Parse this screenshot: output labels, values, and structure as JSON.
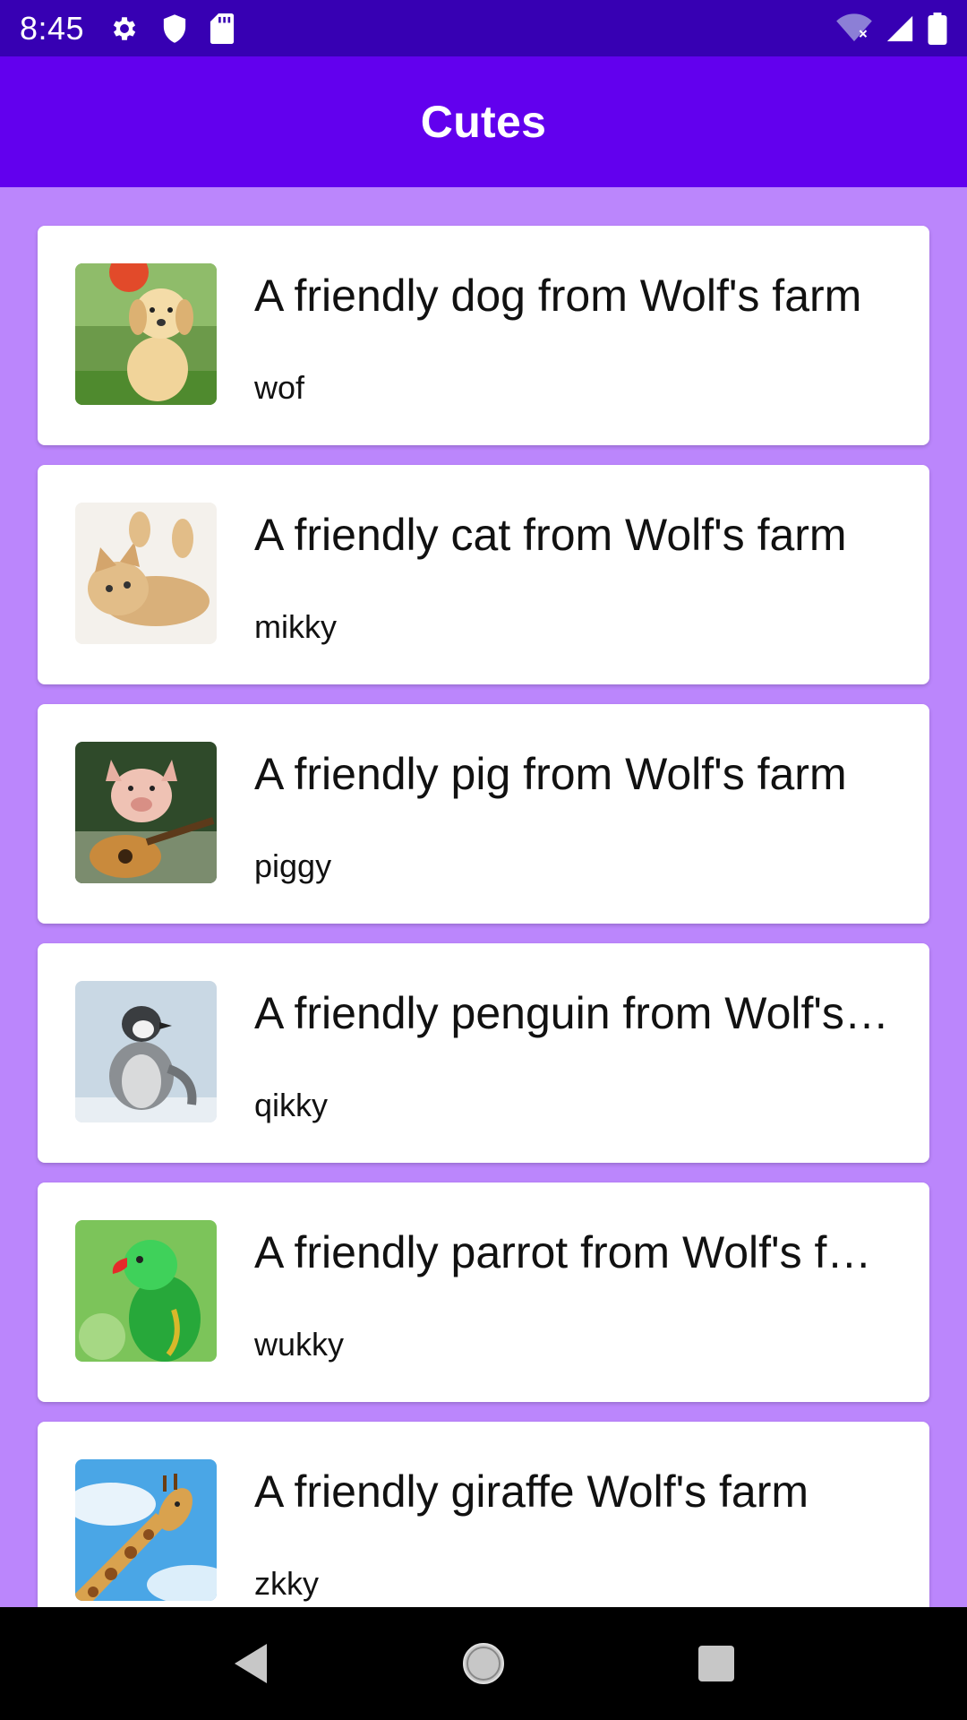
{
  "status_bar": {
    "time": "8:45",
    "left_icons": [
      "settings-icon",
      "shield-icon",
      "sd-card-icon"
    ],
    "right_icons": [
      "wifi-off-icon",
      "signal-icon",
      "battery-icon"
    ]
  },
  "app_bar": {
    "title": "Cutes"
  },
  "items": [
    {
      "title": "A friendly dog from Wolf's farm",
      "subtitle": "wof",
      "image": "dog"
    },
    {
      "title": "A friendly cat from Wolf's farm",
      "subtitle": "mikky",
      "image": "cat"
    },
    {
      "title": "A friendly pig from Wolf's farm",
      "subtitle": "piggy",
      "image": "pig"
    },
    {
      "title": "A friendly penguin from Wolf's farm",
      "subtitle": "qikky",
      "image": "penguin"
    },
    {
      "title": "A friendly parrot from Wolf's farm",
      "subtitle": "wukky",
      "image": "parrot"
    },
    {
      "title": "A friendly giraffe Wolf's farm",
      "subtitle": "zkky",
      "image": "giraffe"
    }
  ],
  "nav_bar": {
    "buttons": [
      "back-icon",
      "home-icon",
      "recents-icon"
    ]
  },
  "colors": {
    "status_bar": "#3700B3",
    "app_bar": "#6200EE",
    "background": "#BB86FC",
    "card": "#FFFFFF"
  }
}
